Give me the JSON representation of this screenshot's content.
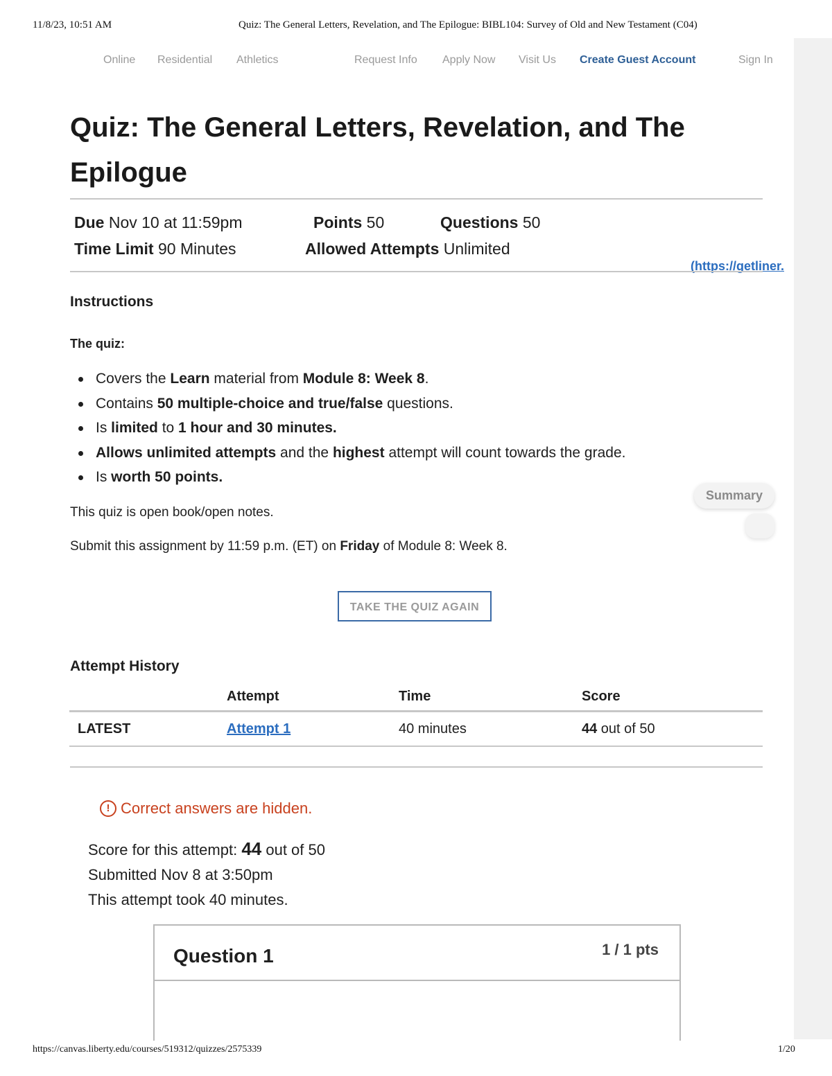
{
  "print_header": {
    "date": "11/8/23, 10:51 AM",
    "title": "Quiz: The General Letters, Revelation, and The Epilogue: BIBL104: Survey of Old and New Testament (C04)"
  },
  "print_footer": {
    "url": "https://canvas.liberty.edu/courses/519312/quizzes/2575339",
    "page": "1/20"
  },
  "nav": {
    "online": "Online",
    "residential": "Residential",
    "athletics": "Athletics",
    "request_info": "Request Info",
    "apply_now": "Apply Now",
    "visit_us": "Visit Us",
    "create_guest": "Create Guest Account",
    "sign_in": "Sign In"
  },
  "quiz": {
    "title": "Quiz: The General Letters, Revelation, and The Epilogue",
    "due_label": "Due",
    "due_value": "Nov 10 at 11:59pm",
    "points_label": "Points",
    "points_value": "50",
    "questions_label": "Questions",
    "questions_value": "50",
    "time_limit_label": "Time Limit",
    "time_limit_value": "90 Minutes",
    "attempts_label": "Allowed Attempts",
    "attempts_value": "Unlimited",
    "getliner_link": "(https://getliner."
  },
  "instructions": {
    "heading": "Instructions",
    "subheading": "The quiz:",
    "rules": [
      [
        "Covers the ",
        "Learn",
        " material from ",
        "Module 8: Week 8",
        "."
      ],
      [
        "Contains ",
        "50 multiple-choice and true/false",
        " questions."
      ],
      [
        "Is ",
        "limited",
        " to ",
        "1 hour and 30 minutes."
      ],
      [
        "Allows unlimited attempts",
        " and the ",
        "highest",
        " attempt will count towards the grade."
      ],
      [
        "Is ",
        "worth 50 points."
      ]
    ],
    "open_book": "This quiz is open book/open notes.",
    "submit_prefix": "Submit this assignment by 11:59 p.m. (ET) on ",
    "submit_bold": "Friday",
    "submit_suffix": " of Module 8: Week 8."
  },
  "summary_label": "Summary",
  "take_again_label": "TAKE THE QUIZ AGAIN",
  "attempt_history": {
    "heading": "Attempt History",
    "columns": [
      "",
      "Attempt",
      "Time",
      "Score"
    ],
    "rows": [
      {
        "status": "LATEST",
        "attempt": "Attempt 1",
        "time": "40 minutes",
        "score": "44",
        "score_suffix": " out of 50"
      }
    ]
  },
  "result": {
    "warning_icon": "!",
    "warning": "Correct answers are hidden.",
    "score_prefix": "Score for this attempt: ",
    "score": "44",
    "score_suffix": " out of 50",
    "submitted": "Submitted Nov 8 at 3:50pm",
    "duration": "This attempt took 40 minutes."
  },
  "question": {
    "title": "Question 1",
    "points": "1 / 1 pts"
  },
  "colors": {
    "link": "#2b6dbf",
    "guest_account": "#2e5f96",
    "warning": "#c8411e",
    "button_border": "#3a6aa6"
  }
}
